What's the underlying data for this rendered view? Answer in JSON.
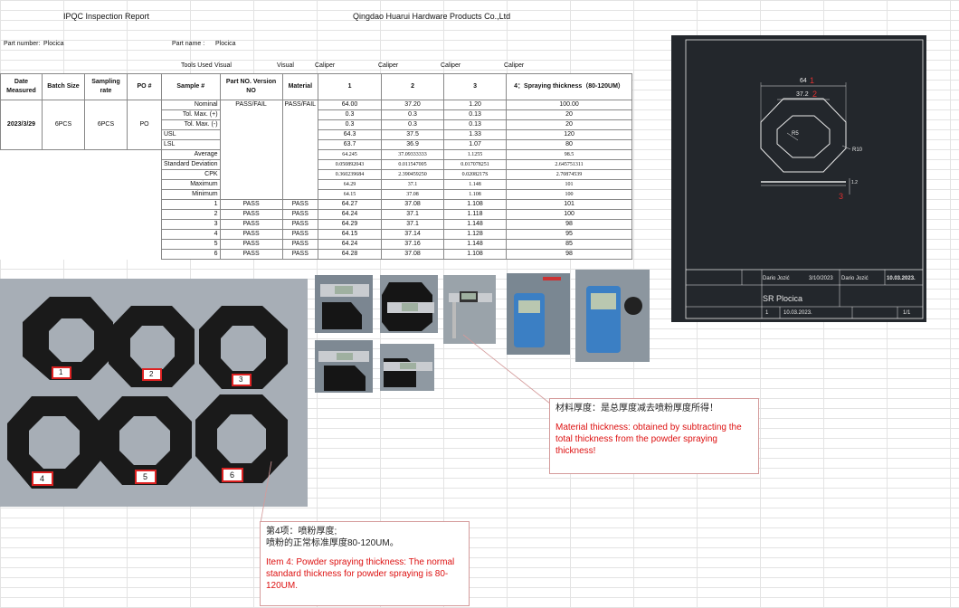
{
  "header": {
    "report_title": "IPQC  Inspection Report",
    "company": "Qingdao Huarui Hardware Products Co.,Ltd",
    "part_number_label": "Part number:",
    "part_number": "Plocica",
    "part_name_label": "Part name :",
    "part_name": "Plocica"
  },
  "tools": {
    "label": "Tools Used",
    "items": [
      "Visual",
      "Visual",
      "Caliper",
      "Caliper",
      "Caliper",
      "Caliper"
    ]
  },
  "table": {
    "headers": [
      "Date Measured",
      "Batch Size",
      "Sampling rate",
      "PO #",
      "Sample #",
      "Part NO. Version NO",
      "Material",
      "1",
      "2",
      "3",
      "4：Spraying thickness（80-120UM）"
    ],
    "date": "2023/3/29",
    "batch_size": "6PCS",
    "sampling_rate": "6PCS",
    "po": "PO",
    "pass_fail": "PASS/FAIL",
    "material_pf": "PASS/FAIL",
    "spec_rows": [
      {
        "label": "Nominal",
        "v": [
          "64.00",
          "37.20",
          "1.20",
          "100.00"
        ]
      },
      {
        "label": "Tol. Max. (+)",
        "v": [
          "0.3",
          "0.3",
          "0.13",
          "20"
        ]
      },
      {
        "label": "Tol. Max. (-)",
        "v": [
          "0.3",
          "0.3",
          "0.13",
          "20"
        ]
      },
      {
        "label": "USL",
        "v": [
          "64.3",
          "37.5",
          "1.33",
          "120"
        ]
      },
      {
        "label": "LSL",
        "v": [
          "63.7",
          "36.9",
          "1.07",
          "80"
        ]
      }
    ],
    "stat_rows": [
      {
        "label": "Average",
        "v": [
          "64.245",
          "37.09333333",
          "1.1255",
          "98.5"
        ]
      },
      {
        "label": "Standard Deviation",
        "v": [
          "0.050892043",
          "0.011547005",
          "0.017078251",
          "2.645751311"
        ]
      },
      {
        "label": "CPK",
        "v": [
          "0.360239684",
          "2.390459250",
          "0.0208217S",
          "2.70874539"
        ]
      },
      {
        "label": "Maximum",
        "v": [
          "64.29",
          "37.1",
          "1.148",
          "101"
        ]
      },
      {
        "label": "Minimum",
        "v": [
          "64.15",
          "37.08",
          "1.108",
          "100"
        ]
      }
    ],
    "samples": [
      {
        "n": "1",
        "pf": "PASS",
        "mat": "PASS",
        "v": [
          "64.27",
          "37.08",
          "1.108",
          "101"
        ]
      },
      {
        "n": "2",
        "pf": "PASS",
        "mat": "PASS",
        "v": [
          "64.24",
          "37.1",
          "1.118",
          "100"
        ]
      },
      {
        "n": "3",
        "pf": "PASS",
        "mat": "PASS",
        "v": [
          "64.29",
          "37.1",
          "1.148",
          "98"
        ]
      },
      {
        "n": "4",
        "pf": "PASS",
        "mat": "PASS",
        "v": [
          "64.15",
          "37.14",
          "1.128",
          "95"
        ]
      },
      {
        "n": "5",
        "pf": "PASS",
        "mat": "PASS",
        "v": [
          "64.24",
          "37.16",
          "1.148",
          "85"
        ]
      },
      {
        "n": "6",
        "pf": "PASS",
        "mat": "PASS",
        "v": [
          "64.28",
          "37.08",
          "1.108",
          "98"
        ]
      }
    ]
  },
  "drawing": {
    "dim_64": "64",
    "dim_37": "37.2",
    "r5": "R5",
    "r10": "R10",
    "callout_1": "1",
    "callout_2": "2",
    "callout_3": "3",
    "thk": "1.2",
    "tb_author1": "Dario Jozić",
    "tb_date1": "3/10/2023",
    "tb_author2": "Dario Jozić",
    "tb_date2": "10.03.2023.",
    "tb_title": "SR Plocica",
    "tb_sheet_no": "1",
    "tb_date3": "10.03.2023.",
    "tb_sheet": "1/1"
  },
  "photos": {
    "part_labels": [
      "1",
      "2",
      "3",
      "4",
      "5",
      "6"
    ]
  },
  "notes": {
    "material_cn": "材料厚度：是总厚度减去喷粉厚度所得！",
    "material_en": "Material thickness: obtained by subtracting the total thickness from the powder spraying thickness!",
    "item4_cn1": "第4项：喷粉厚度;",
    "item4_cn2": "喷粉的正常标准厚度80-120UM。",
    "item4_en": "Item 4: Powder spraying thickness: The normal standard thickness for powder spraying is 80-120UM."
  },
  "colors": {
    "drawing_bg": "#23272c",
    "drawing_line": "#e8e8e8",
    "callout_red": "#e03030",
    "note_red": "#d11111"
  }
}
